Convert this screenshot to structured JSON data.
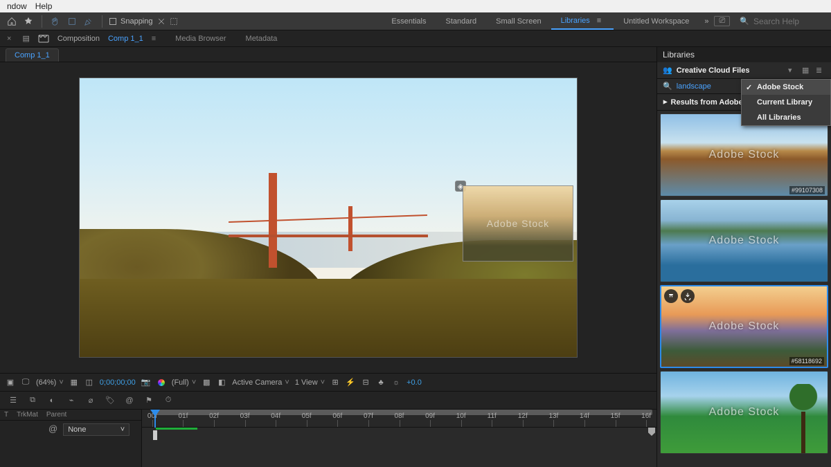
{
  "menubar": {
    "items": [
      "ndow",
      "Help"
    ]
  },
  "toolbar": {
    "snapping_label": "Snapping",
    "workspaces": {
      "items": [
        "Essentials",
        "Standard",
        "Small Screen",
        "Libraries",
        "Untitled Workspace"
      ],
      "active": "Libraries"
    },
    "search_placeholder": "Search Help"
  },
  "tabrow": {
    "composition_label": "Composition",
    "composition_name": "Comp 1_1",
    "other_tabs": [
      "Media Browser",
      "Metadata"
    ]
  },
  "composition": {
    "tab_name": "Comp 1_1"
  },
  "viewer_bar": {
    "zoom": "(64%)",
    "timecode": "0;00;00;00",
    "resolution": "(Full)",
    "camera": "Active Camera",
    "views": "1 View",
    "exposure": "+0.0"
  },
  "timeline": {
    "left_headers": {
      "t": "T",
      "trkmat": "TrkMat",
      "parent": "Parent"
    },
    "parent_value": "None",
    "ruler": [
      "00f",
      "01f",
      "02f",
      "03f",
      "04f",
      "05f",
      "06f",
      "07f",
      "08f",
      "09f",
      "10f",
      "11f",
      "12f",
      "13f",
      "14f",
      "15f",
      "16f"
    ]
  },
  "libraries": {
    "panel_title": "Libraries",
    "header": "Creative Cloud Files",
    "search_value": "landscape",
    "results_label": "Results from Adobe",
    "context_menu": [
      "Adobe Stock",
      "Current Library",
      "All Libraries"
    ],
    "context_selected": "Adobe Stock",
    "watermark": "Adobe Stock",
    "thumbs": [
      {
        "id": "#99107308",
        "selected": false
      },
      {
        "id": "",
        "selected": false
      },
      {
        "id": "#58118692",
        "selected": true
      },
      {
        "id": "",
        "selected": false
      }
    ]
  }
}
